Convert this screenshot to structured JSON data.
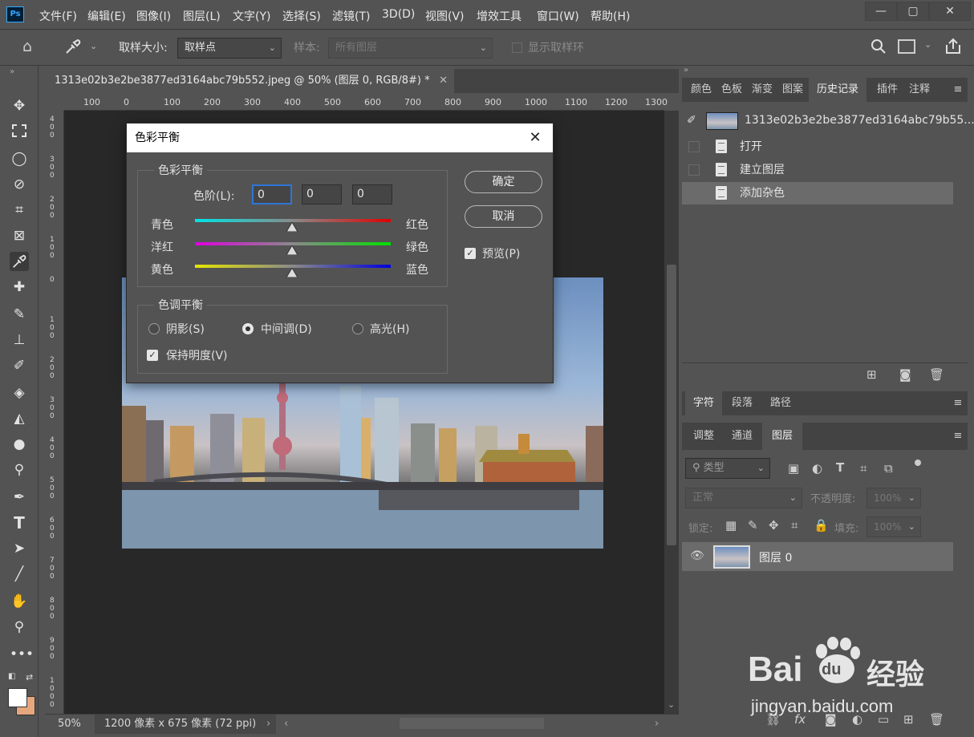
{
  "app": {
    "logo": "Ps"
  },
  "menu": [
    "文件(F)",
    "编辑(E)",
    "图像(I)",
    "图层(L)",
    "文字(Y)",
    "选择(S)",
    "滤镜(T)",
    "3D(D)",
    "视图(V)",
    "增效工具",
    "窗口(W)",
    "帮助(H)"
  ],
  "window_buttons": [
    "—",
    "▢",
    "✕"
  ],
  "options": {
    "sample_size_label": "取样大小:",
    "sample_size_value": "取样点",
    "sample_label": "样本:",
    "sample_value": "所有图层",
    "show_ring_label": "显示取样环"
  },
  "document": {
    "tab_title": "1313e02b3e2be3877ed3164abc79b552.jpeg @ 50% (图层 0, RGB/8#) *",
    "ruler_h": [
      "100",
      "0",
      "100",
      "200",
      "300",
      "400",
      "500",
      "600",
      "700",
      "800",
      "900",
      "1000",
      "1100",
      "1200",
      "1300"
    ],
    "ruler_v": [
      "4\n0\n0",
      "3\n0\n0",
      "2\n0\n0",
      "1\n0\n0",
      "0",
      "1\n0\n0",
      "2\n0\n0",
      "3\n0\n0",
      "4\n0\n0",
      "5\n0\n0",
      "6\n0\n0",
      "7\n0\n0",
      "8\n0\n0",
      "9\n0\n0",
      "1\n0\n0\n0"
    ],
    "zoom": "50%",
    "dimensions": "1200 像素 x 675 像素 (72 ppi)"
  },
  "dialog": {
    "title": "色彩平衡",
    "color_balance_group": "色彩平衡",
    "levels_label": "色阶(L):",
    "levels": [
      "0",
      "0",
      "0"
    ],
    "sliders": [
      {
        "left": "青色",
        "right": "红色",
        "from": "#00e5e5",
        "to": "#e00000"
      },
      {
        "left": "洋红",
        "right": "绿色",
        "from": "#e000e0",
        "to": "#00e000"
      },
      {
        "left": "黄色",
        "right": "蓝色",
        "from": "#e5e500",
        "to": "#0000e0"
      }
    ],
    "tone_group": "色调平衡",
    "tones": [
      "阴影(S)",
      "中间调(D)",
      "高光(H)"
    ],
    "selected_tone": "中间调(D)",
    "preserve_luminosity": "保持明度(V)",
    "ok": "确定",
    "cancel": "取消",
    "preview": "预览(P)"
  },
  "panel_top": {
    "tabs": [
      "颜色",
      "色板",
      "渐变",
      "图案",
      "历史记录",
      "插件",
      "注释"
    ],
    "active": "历史记录",
    "snapshot": "1313e02b3e2be3877ed3164abc79b55...",
    "history": [
      "打开",
      "建立图层",
      "添加杂色"
    ]
  },
  "panel_mid": {
    "tabs": [
      "字符",
      "段落",
      "路径"
    ]
  },
  "panel_layers": {
    "tabs": [
      "调整",
      "通道",
      "图层"
    ],
    "active": "图层",
    "filter_label": "类型",
    "blend_mode": "正常",
    "opacity_label": "不透明度:",
    "opacity": "100%",
    "lock_label": "锁定:",
    "fill_label": "填充:",
    "fill": "100%",
    "layer_name": "图层 0"
  },
  "watermark": {
    "brand": "Bai",
    "brand2": "du",
    "cn": "经验",
    "url": "jingyan.baidu.com"
  }
}
